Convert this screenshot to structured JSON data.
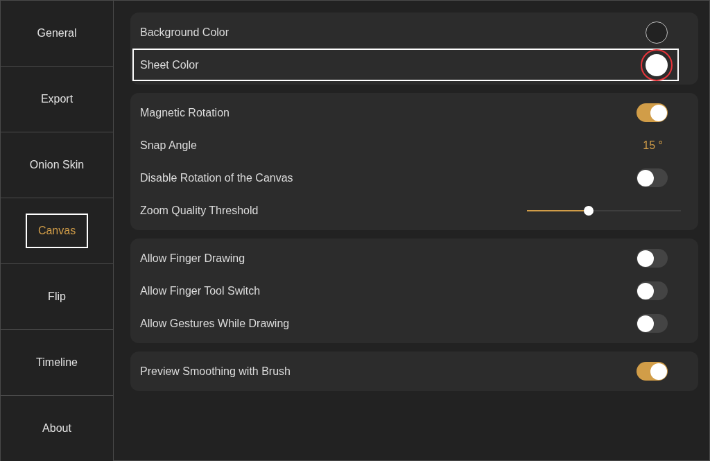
{
  "sidebar": {
    "items": [
      {
        "label": "General",
        "selected": false,
        "outlined": false
      },
      {
        "label": "Export",
        "selected": false,
        "outlined": false
      },
      {
        "label": "Onion Skin",
        "selected": false,
        "outlined": false
      },
      {
        "label": "Canvas",
        "selected": true,
        "outlined": true
      },
      {
        "label": "Flip",
        "selected": false,
        "outlined": false
      },
      {
        "label": "Timeline",
        "selected": false,
        "outlined": false
      },
      {
        "label": "About",
        "selected": false,
        "outlined": false
      }
    ]
  },
  "groups": [
    {
      "rows": [
        {
          "kind": "color",
          "label": "Background Color",
          "color": "#222222",
          "outlined": false,
          "circled": false
        },
        {
          "kind": "color",
          "label": "Sheet Color",
          "color": "#ffffff",
          "outlined": true,
          "circled": true
        }
      ]
    },
    {
      "rows": [
        {
          "kind": "toggle",
          "label": "Magnetic Rotation",
          "on": true
        },
        {
          "kind": "value",
          "label": "Snap Angle",
          "value": "15 °"
        },
        {
          "kind": "toggle",
          "label": "Disable Rotation of the Canvas",
          "on": false
        },
        {
          "kind": "slider",
          "label": "Zoom Quality Threshold",
          "level": 0.4
        }
      ]
    },
    {
      "rows": [
        {
          "kind": "toggle",
          "label": "Allow Finger Drawing",
          "on": false
        },
        {
          "kind": "toggle",
          "label": "Allow Finger Tool Switch",
          "on": false
        },
        {
          "kind": "toggle",
          "label": "Allow Gestures While Drawing",
          "on": false
        }
      ]
    },
    {
      "rows": [
        {
          "kind": "toggle",
          "label": "Preview Smoothing with Brush",
          "on": true
        }
      ]
    }
  ]
}
